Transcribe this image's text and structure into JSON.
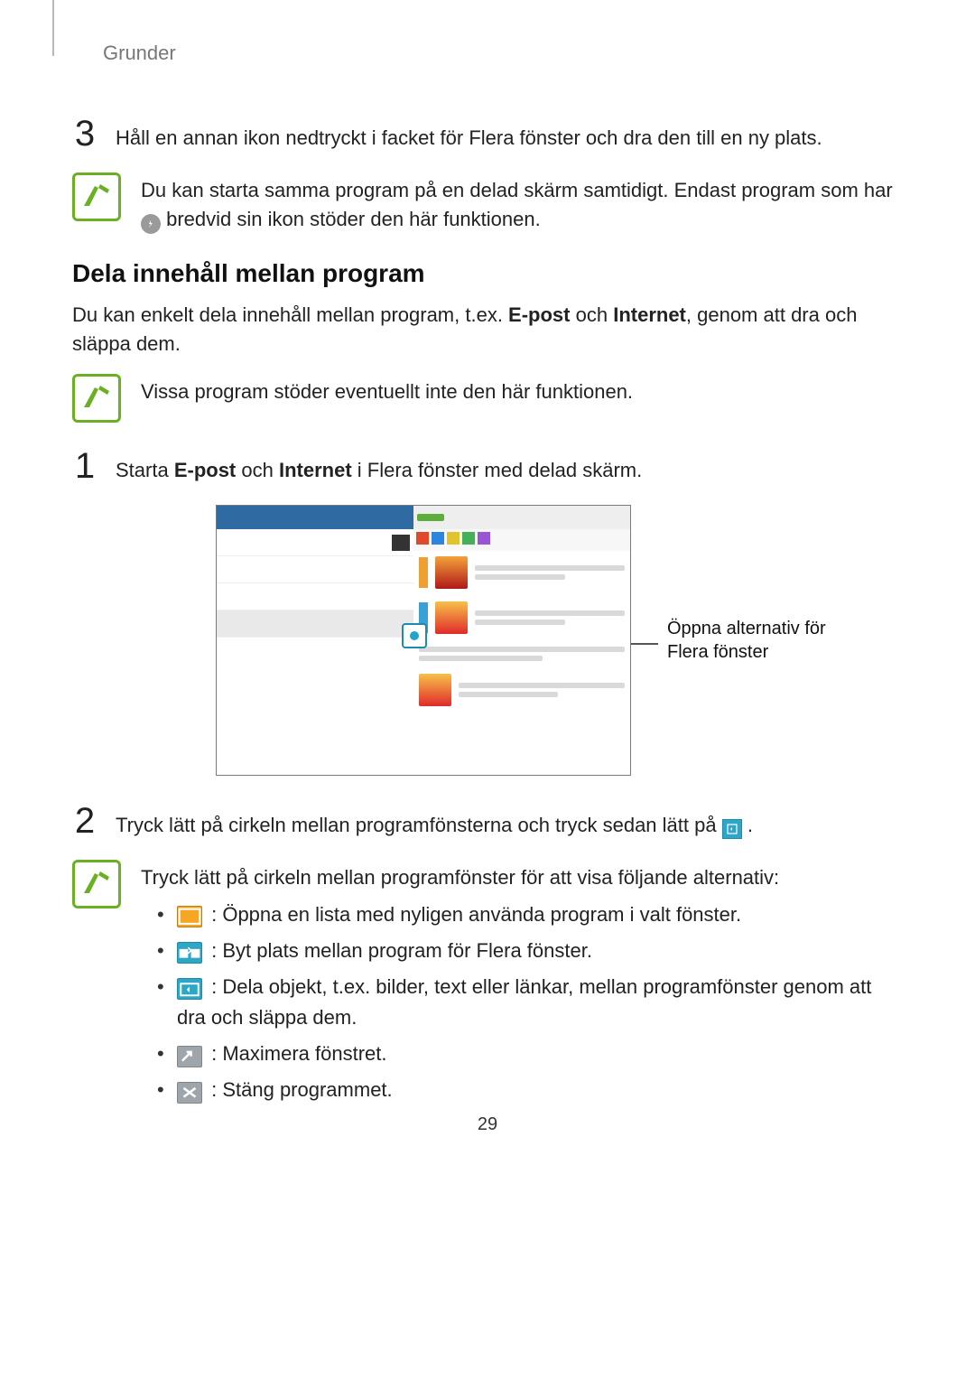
{
  "header": "Grunder",
  "page_number": "29",
  "step3": {
    "num": "3",
    "text": "Håll en annan ikon nedtryckt i facket för Flera fönster och dra den till en ny plats."
  },
  "note1": {
    "text_a": "Du kan starta samma program på en delad skärm samtidigt. Endast program som har ",
    "text_b": " bredvid sin ikon stöder den här funktionen."
  },
  "section_title": "Dela innehåll mellan program",
  "intro": {
    "a": "Du kan enkelt dela innehåll mellan program, t.ex. ",
    "b": "E-post",
    "c": " och ",
    "d": "Internet",
    "e": ", genom att dra och släppa dem."
  },
  "note2": "Vissa program stöder eventuellt inte den här funktionen.",
  "step1": {
    "num": "1",
    "a": "Starta ",
    "b": "E-post",
    "c": " och ",
    "d": "Internet",
    "e": " i Flera fönster med delad skärm."
  },
  "callout": "Öppna alternativ för Flera fönster",
  "step2": {
    "num": "2",
    "a": "Tryck lätt på cirkeln mellan programfönsterna och tryck sedan lätt på ",
    "b": "."
  },
  "note3": {
    "intro": "Tryck lätt på cirkeln mellan programfönster för att visa följande alternativ:",
    "items": [
      " : Öppna en lista med nyligen använda program i valt fönster.",
      " : Byt plats mellan program för Flera fönster.",
      " : Dela objekt, t.ex. bilder, text eller länkar, mellan programfönster genom att dra och släppa dem.",
      " : Maximera fönstret.",
      " : Stäng programmet."
    ]
  }
}
